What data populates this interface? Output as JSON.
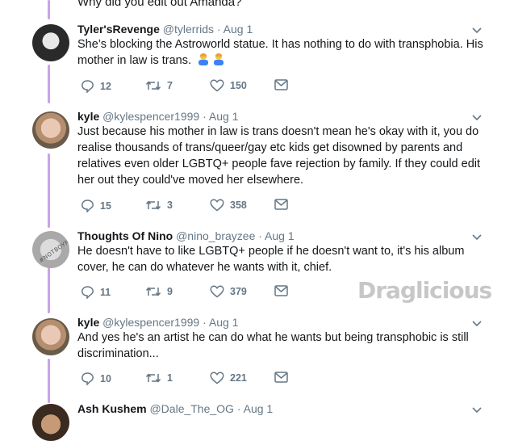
{
  "top_text": "Why did you edit out Amanda?",
  "watermark": "Draglicious",
  "tweets": [
    {
      "name": "Tyler'sRevenge",
      "meta": "@tylerrids · Aug 1",
      "text": "She’s blocking the Astroworld statue. It has nothing to do with transphobia. His mother in law is trans.",
      "emojis": [
        "person-icon",
        "person-icon"
      ],
      "replies": "12",
      "retweets": "7",
      "likes": "150"
    },
    {
      "name": "kyle",
      "meta": "@kylespencer1999 · Aug 1",
      "text": "Just because his mother in law is trans doesn't mean he's okay with it, you do realise thousands of trans/queer/gay etc kids get disowned by parents and relatives even older LGBTQ+ people fave rejection by family. If they could edit her out they could've moved her elsewhere.",
      "replies": "15",
      "retweets": "3",
      "likes": "358"
    },
    {
      "name": "Thoughts Of Nino",
      "meta": "@nino_brayzee · Aug 1",
      "avatar_text": "#NOTBOYNINO",
      "text": "He doesn't have to like LGBTQ+ people if he doesn't want to, it's his album cover, he can do whatever he wants with it, chief.",
      "replies": "11",
      "retweets": "9",
      "likes": "379"
    },
    {
      "name": "kyle",
      "meta": "@kylespencer1999 · Aug 1",
      "text": "And yes he's an artist he can do what he wants but being transphobic is still discrimination...",
      "replies": "10",
      "retweets": "1",
      "likes": "221"
    },
    {
      "name": "Ash Kushem",
      "meta": "@Dale_The_OG · Aug 1"
    }
  ],
  "colors": {
    "thread_line": "#c9a3e6",
    "meta_gray": "#657786"
  }
}
